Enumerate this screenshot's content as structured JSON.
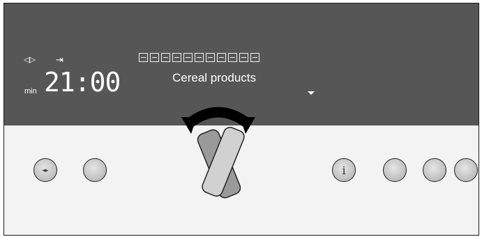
{
  "display": {
    "icons": {
      "arrows": "arrows-left-right-icon",
      "end_time": "end-time-icon"
    },
    "min_label": "min",
    "time": "21:00",
    "program": "Cereal products",
    "mode_icons": [
      "fan-icon",
      "fan-heat-icon",
      "top-bottom-heat-icon",
      "bottom-heat-icon",
      "fan-grill-icon",
      "grill-large-icon",
      "grill-small-icon",
      "pizza-icon",
      "slow-cook-icon",
      "defrost-icon",
      "warming-icon"
    ]
  },
  "buttons": [
    {
      "name": "left-right-button",
      "glyph": "◂▸"
    },
    {
      "name": "left-button-2",
      "glyph": ""
    },
    {
      "name": "info-button",
      "glyph": "i"
    },
    {
      "name": "right-button-1",
      "glyph": ""
    },
    {
      "name": "right-button-2",
      "glyph": ""
    },
    {
      "name": "right-button-3",
      "glyph": ""
    }
  ],
  "colors": {
    "display_bg": "#565656",
    "panel_bg": "#f3f3f3",
    "knob": "#c6c6c6"
  }
}
